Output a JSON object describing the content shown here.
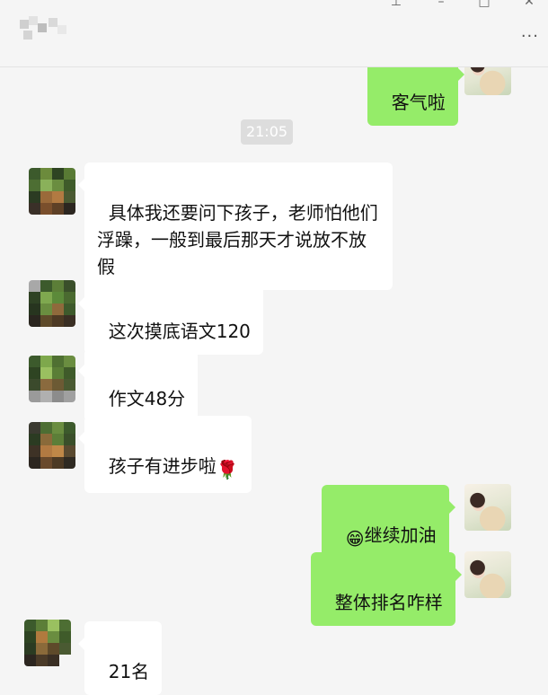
{
  "window": {
    "pin_icon": "pin-icon",
    "minimize_icon": "minimize-icon",
    "maximize_icon": "maximize-icon",
    "close_icon": "close-icon",
    "more_label": "···"
  },
  "colors": {
    "background": "#f5f5f5",
    "bubble_left": "#ffffff",
    "bubble_right": "#95ec69",
    "timestamp_bg": "#dddddd"
  },
  "timestamp": "21:05",
  "messages": [
    {
      "side": "right",
      "text": "客气啦"
    },
    {
      "side": "left",
      "text": "具体我还要问下孩子，老师怕他们\n浮躁，一般到最后那天才说放不放\n假"
    },
    {
      "side": "left",
      "text": "这次摸底语文120"
    },
    {
      "side": "left",
      "text": "作文48分"
    },
    {
      "side": "left",
      "text": "孩子有进步啦",
      "emoji": "🌹",
      "emoji_icon": "rose-emoji-icon"
    },
    {
      "side": "right",
      "text": "继续加油",
      "emoji": "😁",
      "emoji_icon": "grin-emoji-icon"
    },
    {
      "side": "right",
      "text": "整体排名咋样"
    },
    {
      "side": "left",
      "text": "21名"
    }
  ]
}
